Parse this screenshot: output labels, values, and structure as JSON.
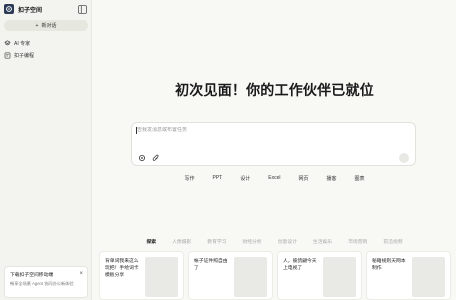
{
  "sidebar": {
    "brand_name": "扣子空间",
    "new_chat_label": "新对话",
    "items": [
      {
        "label": "AI 专家",
        "icon": "expert-icon"
      },
      {
        "label": "扣子编程",
        "icon": "code-icon"
      }
    ],
    "promo": {
      "title": "下载扣子空间移动端",
      "subtitle": "畅享全场景 Agent 协同办公新体验"
    }
  },
  "main": {
    "title": "初次见面！你的工作伙伴已就位",
    "input_placeholder": "告我发消息或布置任务",
    "quick_actions": [
      "写作",
      "PPT",
      "设计",
      "Excel",
      "网页",
      "播客",
      "图表"
    ],
    "tabs": [
      "探索",
      "人像摄影",
      "教育学习",
      "财经分析",
      "创意设计",
      "生活娱乐",
      "市场营销",
      "前沿视频"
    ],
    "active_tab": "探索",
    "cards": [
      {
        "text": "背单词我来这么玩把！手绘词卡模板分享"
      },
      {
        "text": "帐子证件照自由了"
      },
      {
        "text": "人，彼鸽翩今天上电视了"
      },
      {
        "text": "秘籍规则天网本制作"
      }
    ]
  },
  "colors": {
    "background": "#f8f8f5",
    "sidebar": "#f3f3ef",
    "accent": "#2b3a55"
  }
}
